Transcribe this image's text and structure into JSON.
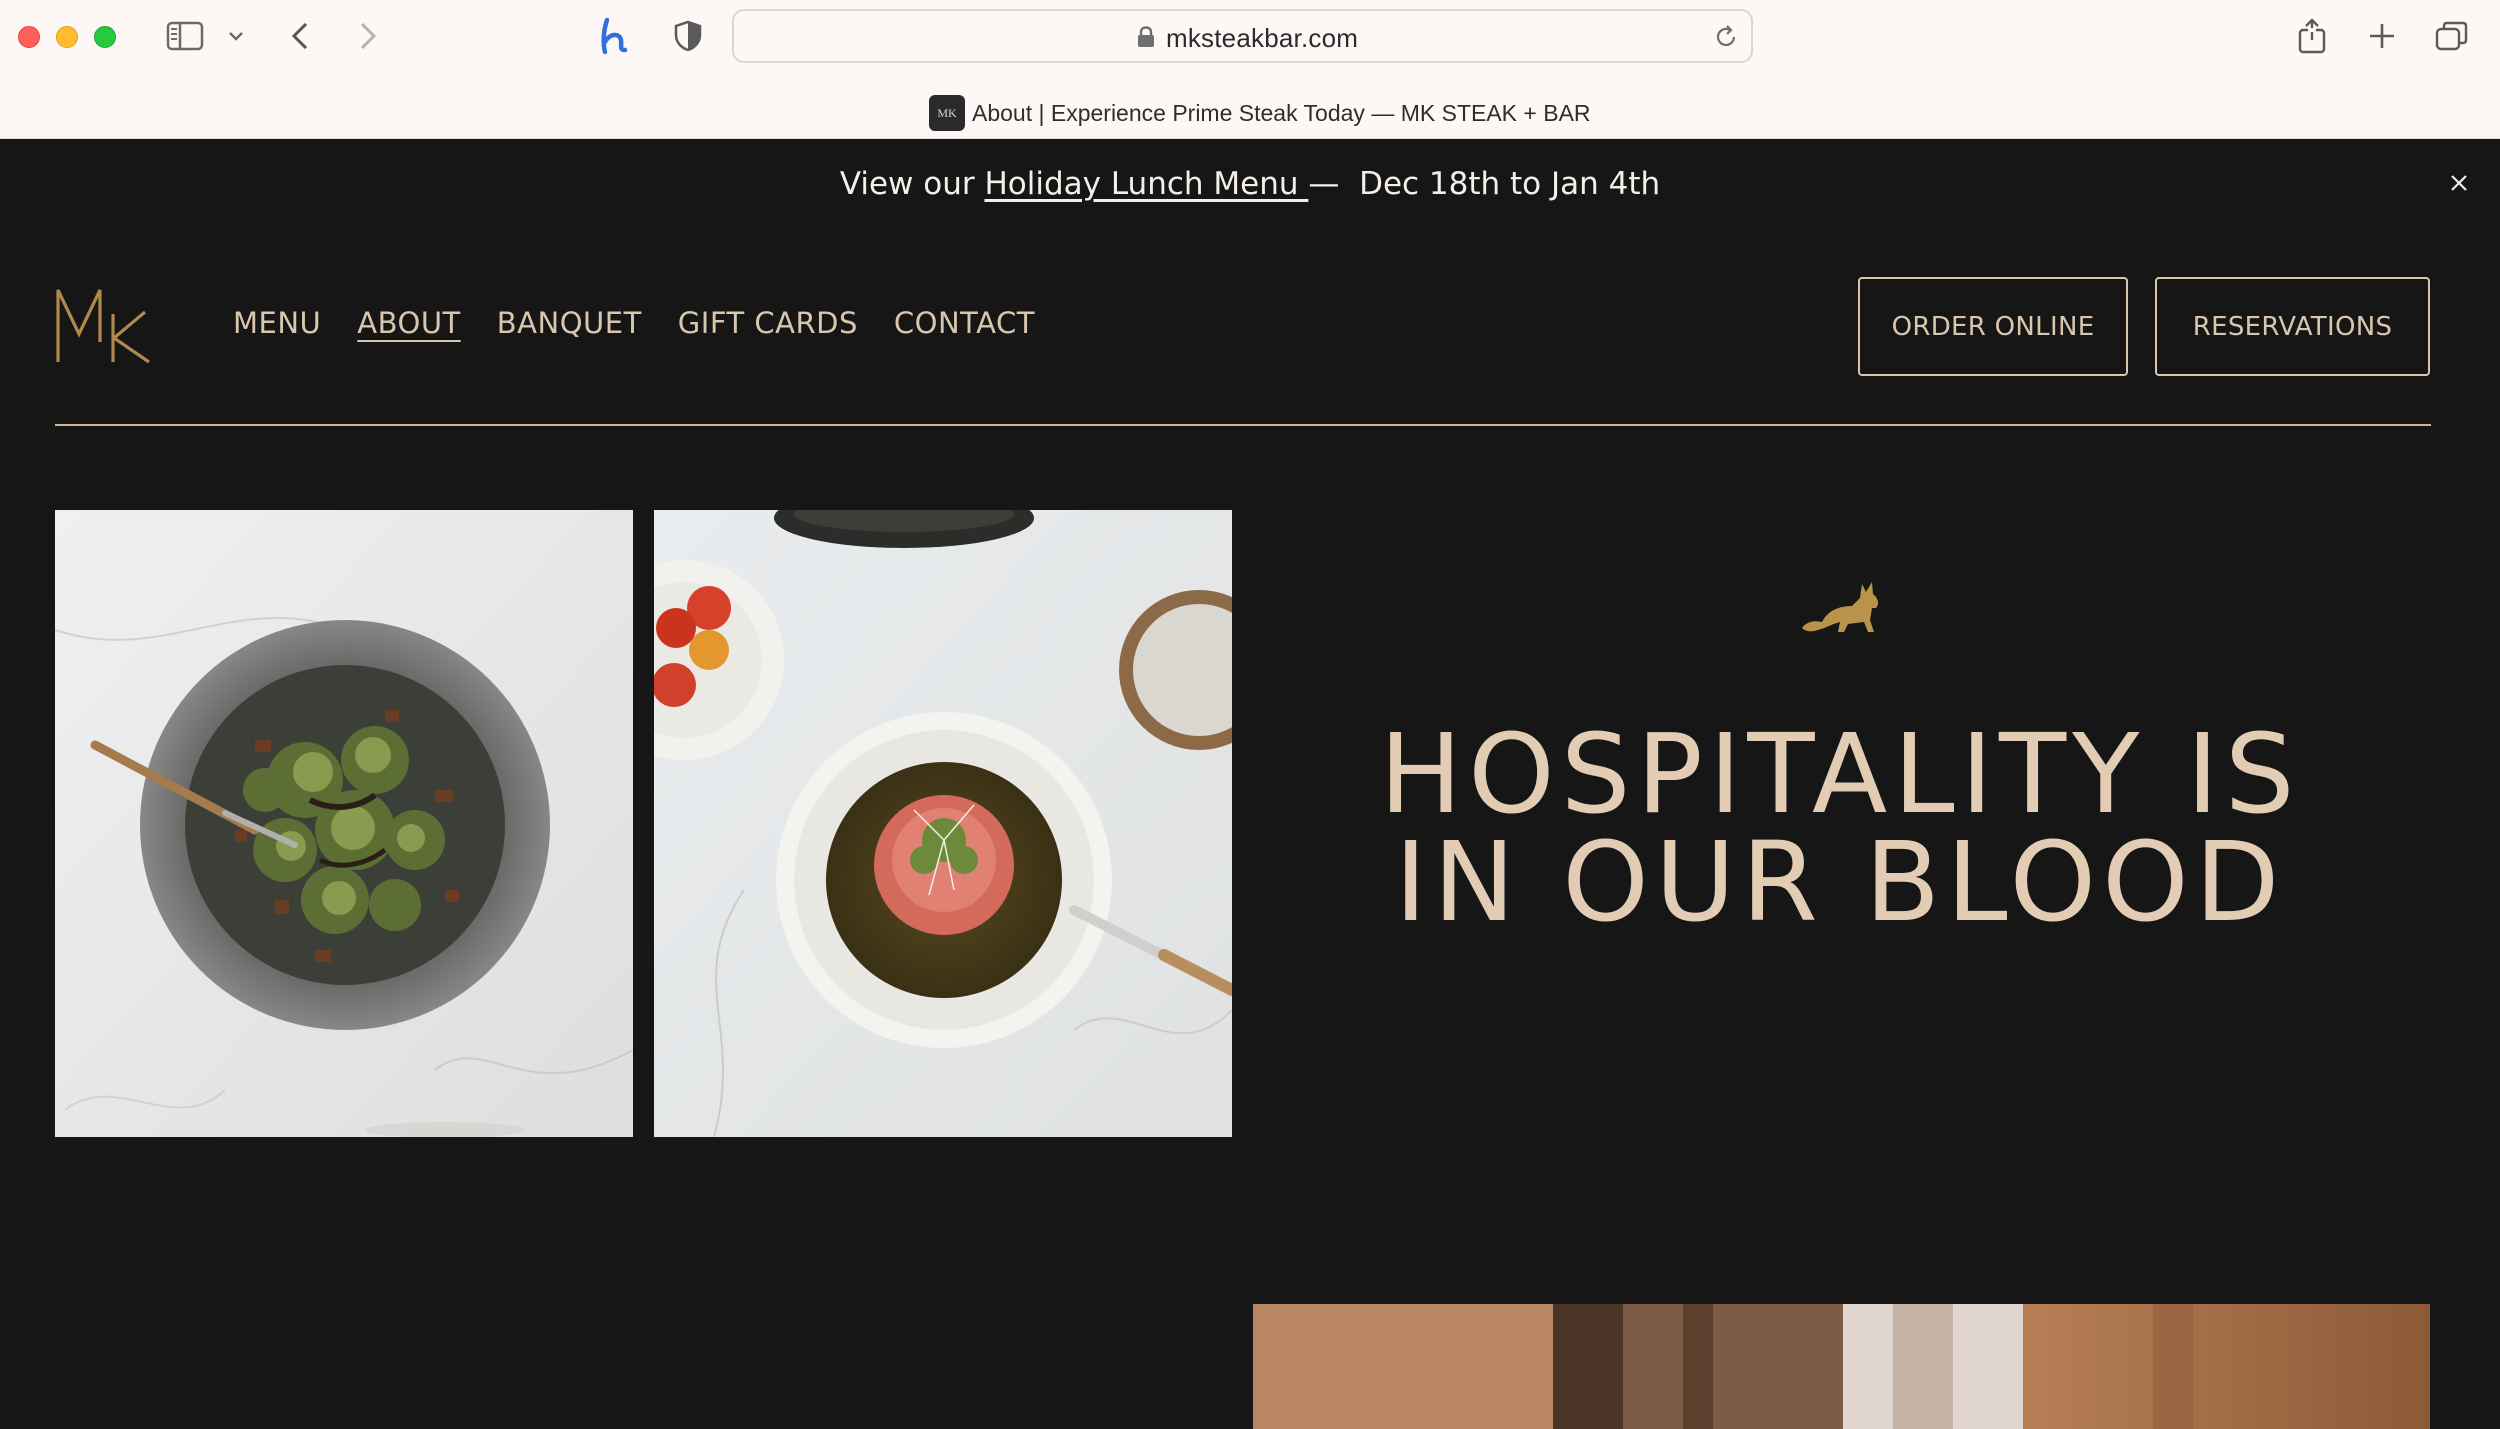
{
  "browser": {
    "url": "mksteakbar.com",
    "tab_title": "About | Experience Prime Steak Today — MK STEAK + BAR",
    "favicon_text": "MK"
  },
  "announcement": {
    "prefix": "View our ",
    "link": "Holiday Lunch Menu ",
    "suffix": "—  Dec 18th to Jan 4th"
  },
  "header": {
    "logo_text": "MK",
    "nav": [
      {
        "label": "MENU",
        "active": false
      },
      {
        "label": "ABOUT",
        "active": true
      },
      {
        "label": "BANQUET",
        "active": false
      },
      {
        "label": "GIFT CARDS",
        "active": false
      },
      {
        "label": "CONTACT",
        "active": false
      }
    ],
    "order_online": "ORDER ONLINE",
    "reservations": "RESERVATIONS"
  },
  "hero": {
    "title_line1": "HOSPITALITY IS",
    "title_line2": "IN OUR BLOOD"
  },
  "colors": {
    "background": "#161616",
    "accent": "#d9c6ae",
    "gold": "#b8934a",
    "heading": "#e2ccb3"
  }
}
